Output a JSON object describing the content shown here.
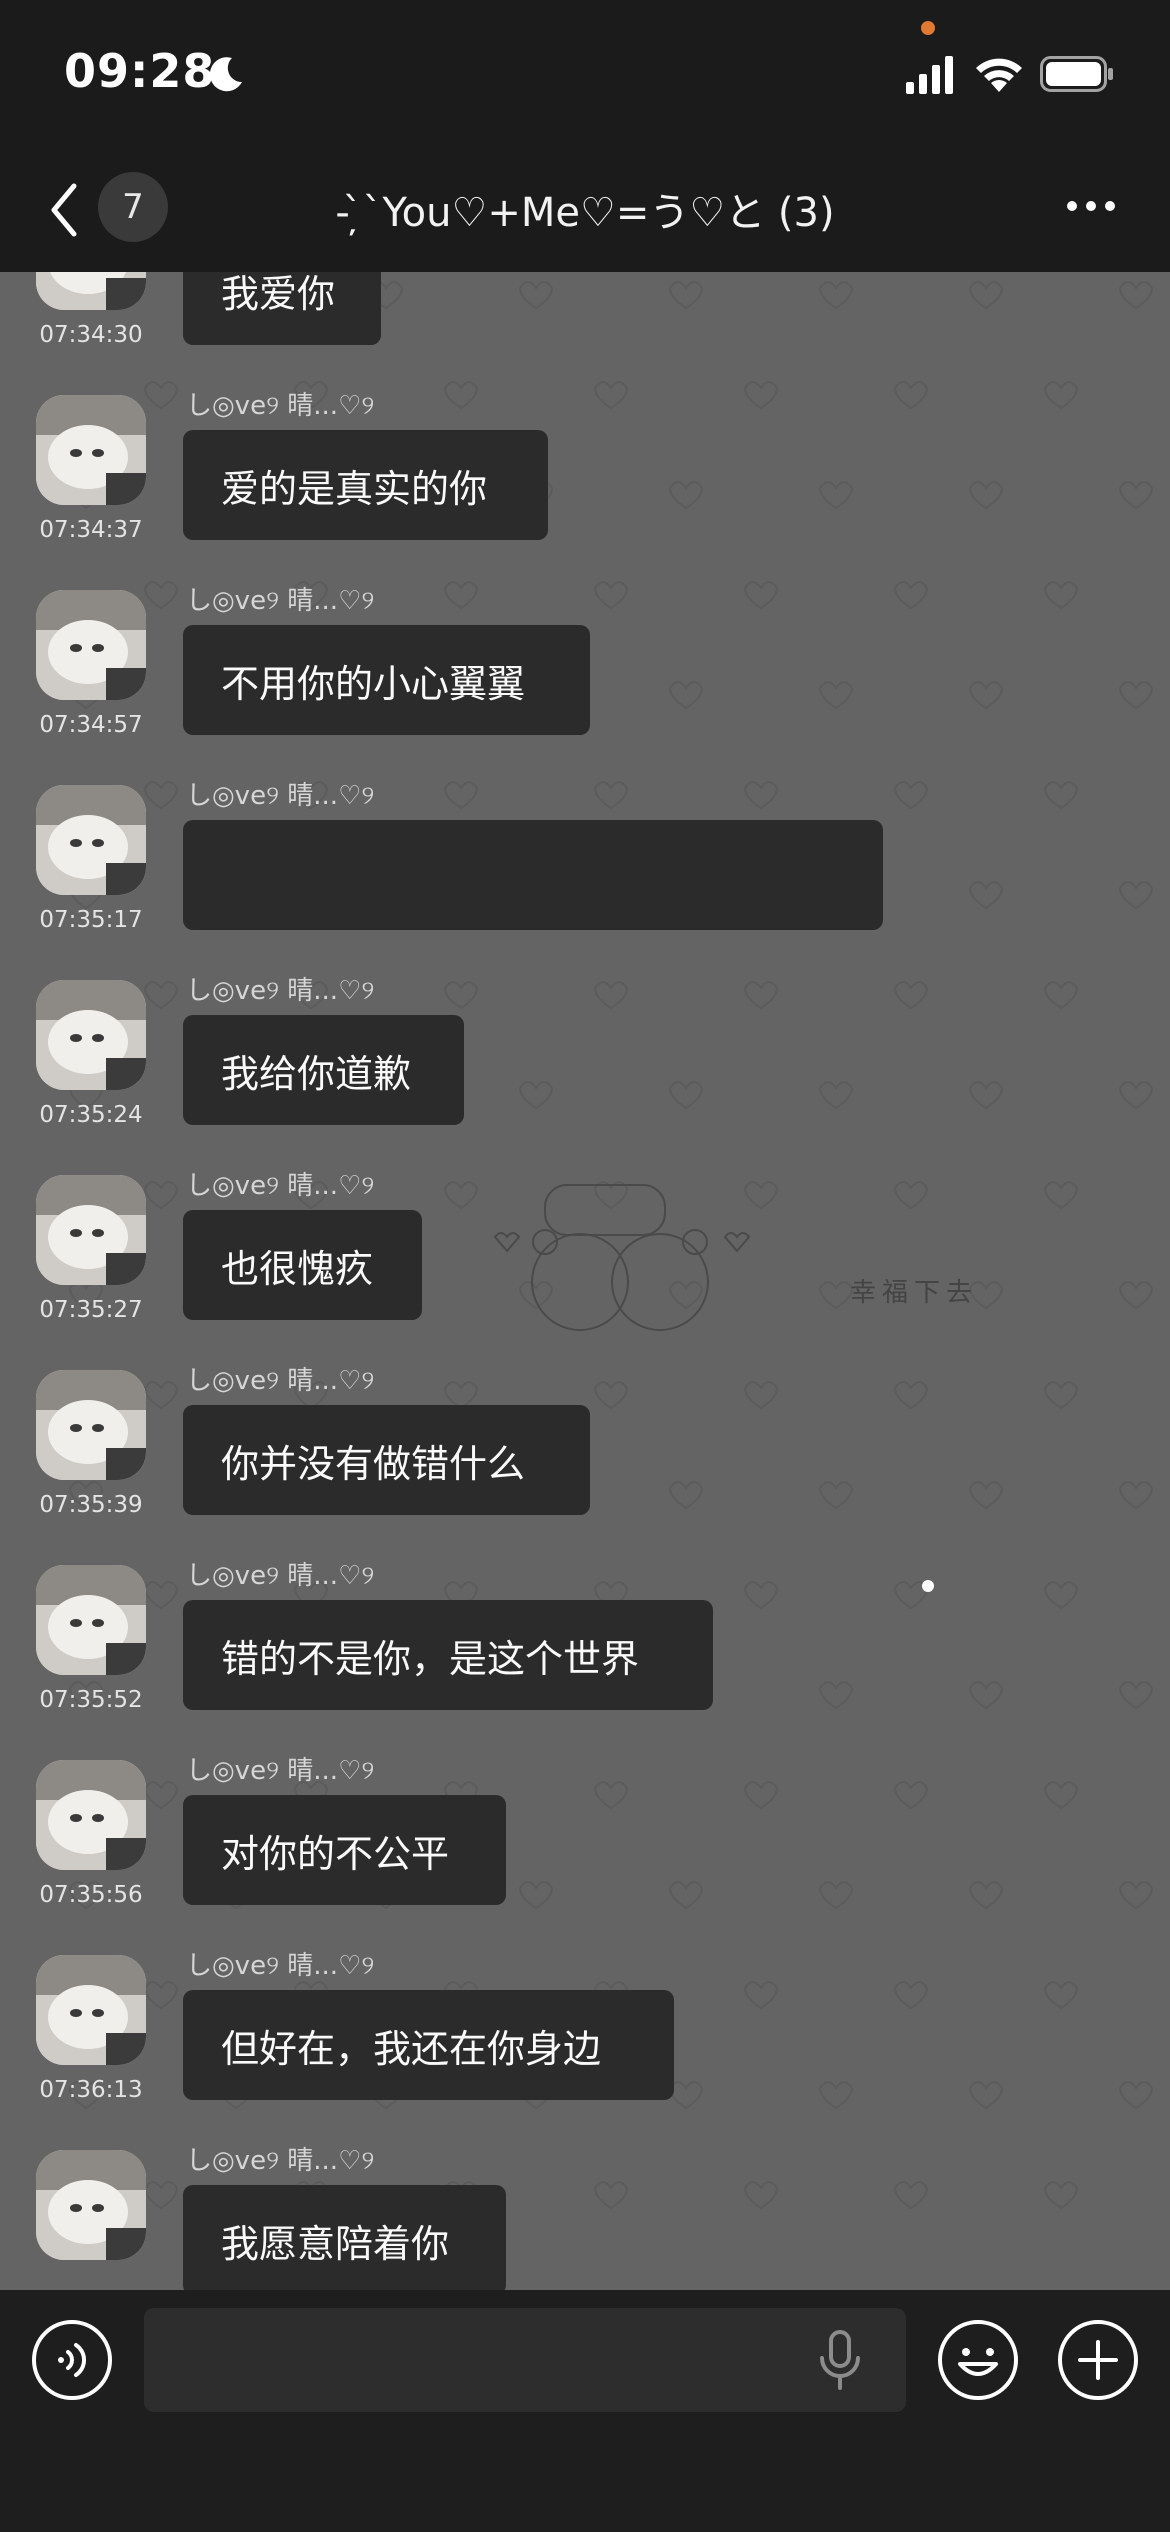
{
  "status_bar": {
    "time": "09:28"
  },
  "nav": {
    "badge": "7",
    "title": "- ̦̀`You♡+Me♡=う♡と (3)"
  },
  "wallpaper": {
    "stamp_text": "幸福下去"
  },
  "messages": [
    {
      "sender": "",
      "text": "我爱你",
      "time": "07:34:30"
    },
    {
      "sender": "し◎ve୨ 晴...♡୨",
      "text": "爱的是真实的你",
      "time": "07:34:37"
    },
    {
      "sender": "し◎ve୨ 晴...♡୨",
      "text": "不用你的小心翼翼",
      "time": "07:34:57"
    },
    {
      "sender": "し◎ve୨ 晴...♡୨",
      "text": "",
      "time": "07:35:17"
    },
    {
      "sender": "し◎ve୨ 晴...♡୨",
      "text": "我给你道歉",
      "time": "07:35:24"
    },
    {
      "sender": "し◎ve୨ 晴...♡୨",
      "text": "也很愧疚",
      "time": "07:35:27"
    },
    {
      "sender": "し◎ve୨ 晴...♡୨",
      "text": "你并没有做错什么",
      "time": "07:35:39"
    },
    {
      "sender": "し◎ve୨ 晴...♡୨",
      "text": "错的不是你，是这个世界",
      "time": "07:35:52"
    },
    {
      "sender": "し◎ve୨ 晴...♡୨",
      "text": "对你的不公平",
      "time": "07:35:56"
    },
    {
      "sender": "し◎ve୨ 晴...♡୨",
      "text": "但好在，我还在你身边",
      "time": "07:36:13"
    },
    {
      "sender": "し◎ve୨ 晴...♡୨",
      "text": "我愿意陪着你",
      "time": ""
    }
  ],
  "input": {
    "placeholder": ""
  },
  "icons": {
    "back": "chevron-left-icon",
    "more": "more-dots-icon",
    "voice": "voice-icon",
    "mic": "microphone-icon",
    "emoji": "emoji-icon",
    "plus": "plus-icon"
  },
  "colors": {
    "bar_bg": "#1b1b1b",
    "chat_bg": "#646464",
    "bubble_bg": "#2b2b2b",
    "accent_dot": "#e07a32"
  }
}
